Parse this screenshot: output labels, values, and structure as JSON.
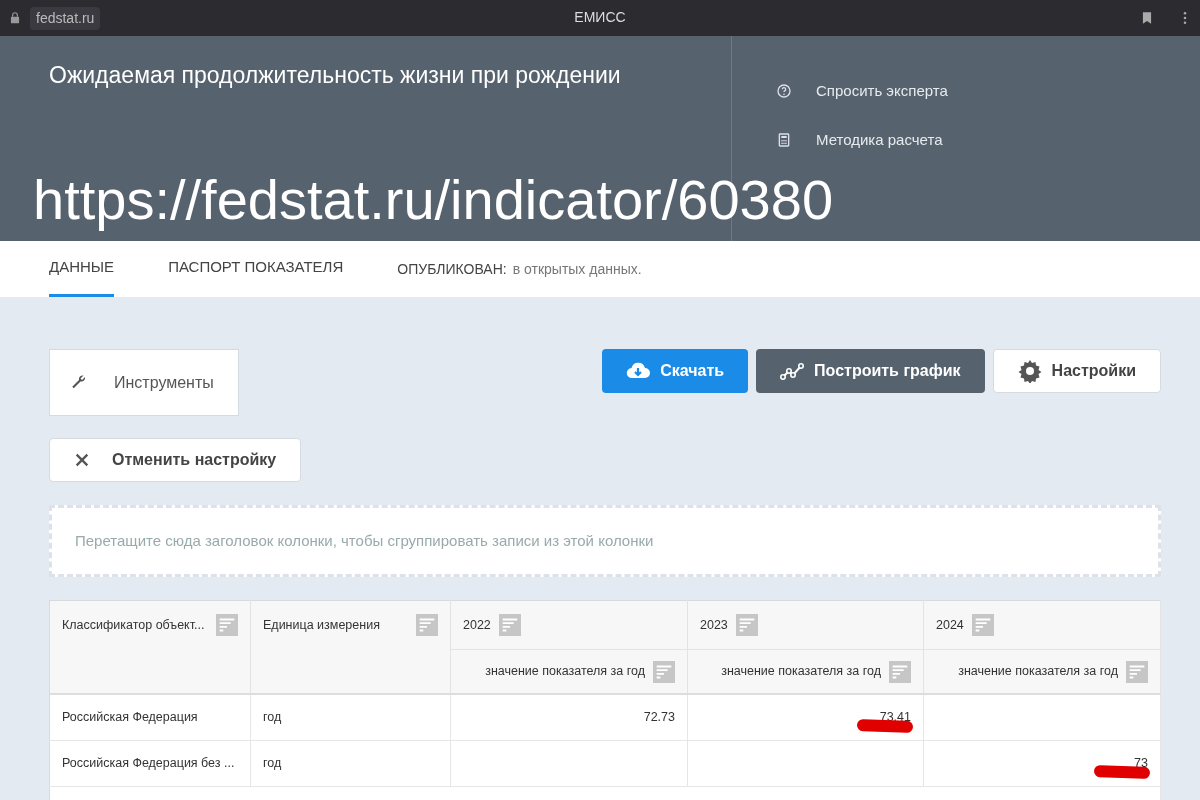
{
  "browser": {
    "address": "fedstat.ru",
    "title": "ЕМИСС"
  },
  "header": {
    "title": "Ожидаемая продолжительность жизни при рождении",
    "links": [
      {
        "label": "Спросить эксперта",
        "kind": "help"
      },
      {
        "label": "Методика расчета",
        "kind": "calculator"
      }
    ],
    "overlay_url": "https://fedstat.ru/indicator/60380"
  },
  "tabs": [
    {
      "label": "ДАННЫЕ",
      "selected": true
    },
    {
      "label": "ПАСПОРТ ПОКАЗАТЕЛЯ",
      "selected": false
    }
  ],
  "published": {
    "label": "ОПУБЛИКОВАН:",
    "value": "в открытых данных."
  },
  "tools": {
    "label": "Инструменты"
  },
  "actions": [
    {
      "label": "Скачать",
      "kind": "download"
    },
    {
      "label": "Построить график",
      "kind": "chart"
    },
    {
      "label": "Настройки",
      "kind": "settings"
    }
  ],
  "reset_button": {
    "label": "Отменить настройку"
  },
  "group_zone": {
    "placeholder": "Перетащите сюда заголовок колонки, чтобы сгруппировать записи из этой колонки"
  },
  "table": {
    "columns": [
      {
        "label": "Классификатор объект..."
      },
      {
        "label": "Единица измерения"
      },
      {
        "label": "2022",
        "sub_label": "значение показателя за год"
      },
      {
        "label": "2023",
        "sub_label": "значение показателя за год"
      },
      {
        "label": "2024",
        "sub_label": "значение показателя за год"
      }
    ],
    "rows": [
      {
        "cells": [
          {
            "text": "Российская Федерация",
            "marked": false
          },
          {
            "text": "год",
            "marked": false
          },
          {
            "text": "72.73",
            "marked": false
          },
          {
            "text": "73.41",
            "marked": true
          },
          {}
        ]
      },
      {
        "cells": [
          {
            "text": "Российская Федерация без ...",
            "marked": false
          },
          {
            "text": "год",
            "marked": false
          },
          {},
          {},
          {
            "text": "73",
            "marked": true
          }
        ]
      }
    ]
  }
}
